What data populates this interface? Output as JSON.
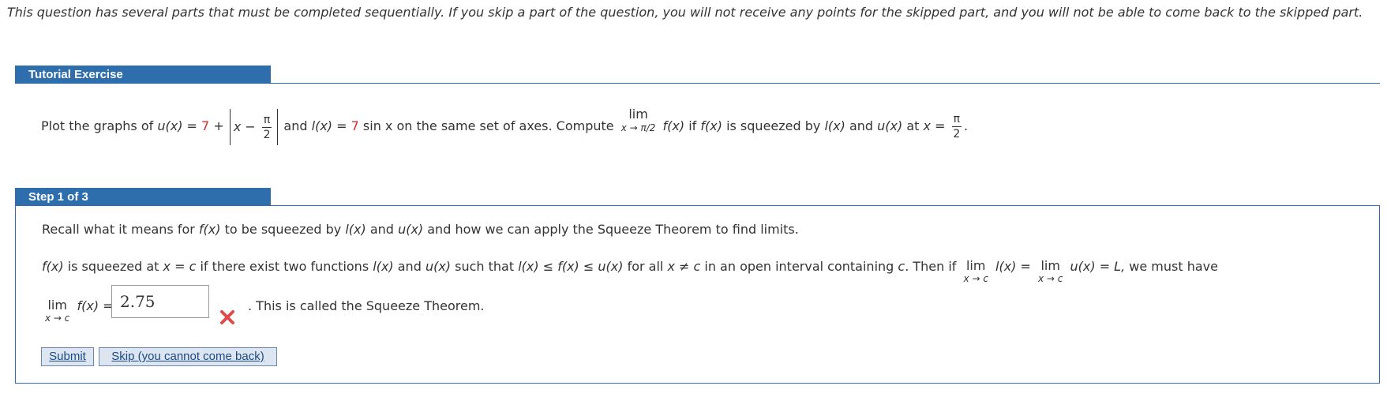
{
  "instructions": "This question has several parts that must be completed sequentially. If you skip a part of the question, you will not receive any points for the skipped part, and you will not be able to come back to the skipped part.",
  "tutorial": {
    "header": "Tutorial Exercise",
    "problem": {
      "t1": "Plot the graphs of",
      "u_fn": "u(x)",
      "eq": "=",
      "const7": "7",
      "plus": "+",
      "abs_x": "x",
      "minus": "−",
      "pi": "π",
      "two": "2",
      "t_and": "and",
      "l_fn": "l(x)",
      "sin_const": "7",
      "sin_x": "sin x",
      "t2": "on the same set of axes. Compute",
      "lim": "lim",
      "lim_sub": "x → π/2",
      "f_fn": "f(x)",
      "t3": "if",
      "f_fn2": "f(x)",
      "t4": "is squeezed by",
      "l_fn2": "l(x)",
      "t_and2": "and",
      "u_fn2": "u(x)",
      "t5": "at",
      "x_eq": "x =",
      "pi2": "π",
      "two2": "2",
      "period": "."
    }
  },
  "step": {
    "header": "Step 1 of 3",
    "recall": {
      "t1": "Recall what it means for",
      "f": "f(x)",
      "t2": "to be squeezed by",
      "l": "l(x)",
      "t3": "and",
      "u": "u(x)",
      "t4": "and how we can apply the Squeeze Theorem to find limits."
    },
    "def": {
      "f": "f(x)",
      "t1": "is squeezed at",
      "xc": "x = c",
      "t2": "if there exist two functions",
      "l": "l(x)",
      "t3": "and",
      "u": "u(x)",
      "t4": "such that",
      "ineq": "l(x) ≤ f(x) ≤ u(x)",
      "t5": "for all",
      "xnec": "x ≠ c",
      "t6": "in an open interval containing",
      "c": "c",
      "t7": ". Then if",
      "lim": "lim",
      "lim_sub": "x → c",
      "l2": "l(x)",
      "eq": "=",
      "lim2": "lim",
      "lim_sub2": "x → c",
      "u2": "u(x)",
      "eqL": "= L,",
      "t8": "we must have"
    },
    "answer_line": {
      "lim": "lim",
      "lim_sub": "x → c",
      "f": "f(x)",
      "eq": "=",
      "after": ". This is called the Squeeze Theorem."
    },
    "answer_value": "2.75",
    "submit_label": "Submit",
    "skip_label": "Skip (you cannot come back)"
  },
  "colors": {
    "header_bg": "#2f6ead",
    "highlight": "#d92b2b",
    "wrong": "#e04a4a"
  }
}
